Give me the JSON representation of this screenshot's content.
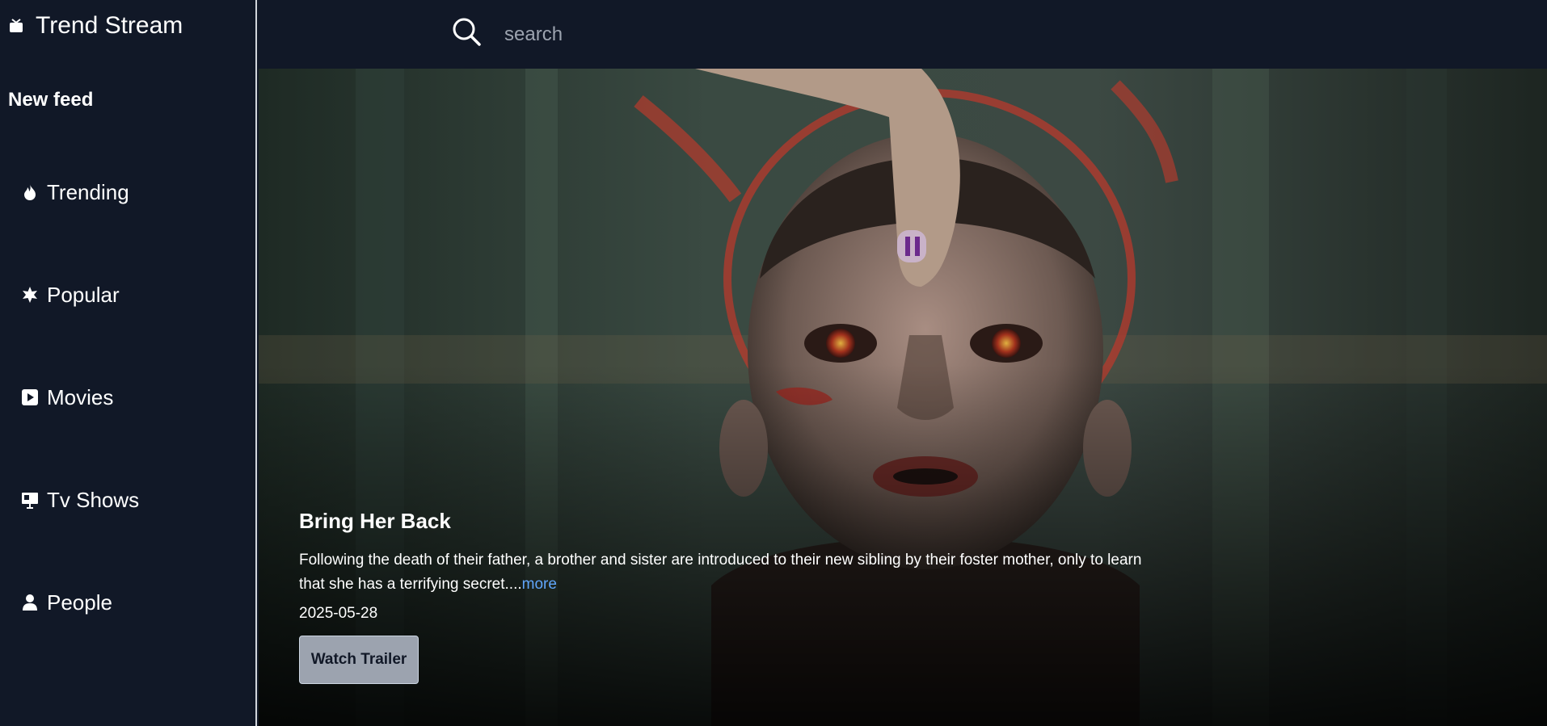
{
  "brand": {
    "title": "Trend Stream",
    "icon": "tv-icon"
  },
  "sidebar": {
    "section_label": "New feed",
    "items": [
      {
        "label": "Trending",
        "icon": "fire-icon"
      },
      {
        "label": "Popular",
        "icon": "star-burst-icon"
      },
      {
        "label": "Movies",
        "icon": "play-square-icon"
      },
      {
        "label": "Tv Shows",
        "icon": "presentation-icon"
      },
      {
        "label": "People",
        "icon": "person-icon"
      }
    ]
  },
  "search": {
    "placeholder": "search",
    "value": ""
  },
  "hero": {
    "title": "Bring Her Back",
    "description": "Following the death of their father, a brother and sister are introduced to their new sibling by their foster mother, only to learn that she has a terrifying secret....",
    "more_label": "more",
    "release_date": "2025-05-28",
    "watch_label": "Watch Trailer"
  },
  "colors": {
    "background": "#111827",
    "link": "#60a5fa",
    "button": "#9ca3af"
  }
}
